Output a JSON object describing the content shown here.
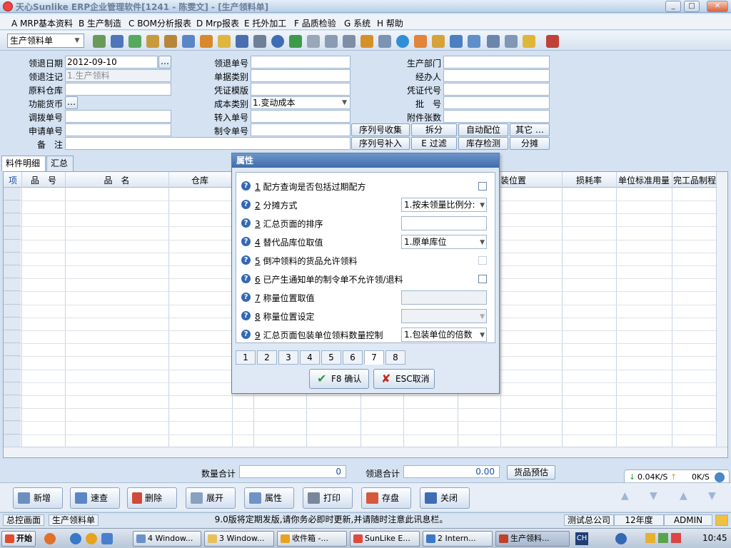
{
  "window": {
    "title": "天心Sunlike ERP企业管理软件[1241 - 陈雯文] - [生产领料单]",
    "min": "_",
    "max": "□",
    "close": "✕"
  },
  "menu": [
    "A MRP基本资料",
    "B 生产制造",
    "C BOM分析报表",
    "D Mrp报表",
    "E 托外加工",
    "F 品质检验",
    "G 系统",
    "H 帮助"
  ],
  "toolbar": {
    "doc_type": "生产领料单"
  },
  "form": {
    "fields": [
      {
        "label": "领退日期",
        "value": "2012-09-10"
      },
      {
        "label": "领退注记",
        "value": "1.生产领料"
      },
      {
        "label": "原料仓库",
        "value": ""
      },
      {
        "label": "功能货币",
        "value": ""
      },
      {
        "label": "调拨单号",
        "value": ""
      },
      {
        "label": "申请单号",
        "value": ""
      },
      {
        "label": "备　注",
        "value": ""
      },
      {
        "label": "领退单号",
        "value": ""
      },
      {
        "label": "单据类别",
        "value": ""
      },
      {
        "label": "凭证模版",
        "value": ""
      },
      {
        "label": "成本类别",
        "value": "1.变动成本"
      },
      {
        "label": "转入单号",
        "value": ""
      },
      {
        "label": "制令单号",
        "value": ""
      },
      {
        "label": "生产部门",
        "value": ""
      },
      {
        "label": "经办人",
        "value": ""
      },
      {
        "label": "凭证代号",
        "value": ""
      },
      {
        "label": "批　号",
        "value": ""
      },
      {
        "label": "附件张数",
        "value": ""
      }
    ],
    "ellipsis": "…",
    "buttons": [
      "序列号收集",
      "拆分",
      "自动配位",
      "其它 …",
      "序列号补入",
      "E 过滤",
      "库存检测",
      "分摊"
    ]
  },
  "tabs": [
    "料件明细",
    "汇总"
  ],
  "grid": {
    "columns": [
      "项",
      "品　号",
      "品　名",
      "仓库",
      "装位置",
      "损耗率",
      "单位标准用量",
      "完工品制程"
    ]
  },
  "summary": {
    "qty_label": "数量合计",
    "qty_value": "0",
    "return_label": "领退合计",
    "return_value": "0.00",
    "preview": "货品预估",
    "net_down": "0.04K/S",
    "net_up": "0K/S"
  },
  "bottom_buttons": [
    "新增",
    "速查",
    "删除",
    "展开",
    "属性",
    "打印",
    "存盘",
    "关闭"
  ],
  "status": {
    "home": "总控画面",
    "doc": "生产领料单",
    "message": "9.0版将定期发版,请你务必即时更新,并请随时注意此讯息栏。",
    "company": "测试总公司",
    "year": "12年度",
    "user": "ADMIN"
  },
  "taskbar": {
    "start": "开始",
    "tasks": [
      "4 Window...",
      "3 Window...",
      "收件箱 -...",
      "SunLike E...",
      "2 Intern...",
      "生产领料..."
    ],
    "lang": "CH",
    "time": "10:45"
  },
  "dialog": {
    "title": "属性",
    "props": [
      {
        "num": "1",
        "text": "配方查询是否包括过期配方",
        "type": "checkbox",
        "value": ""
      },
      {
        "num": "2",
        "text": "分摊方式",
        "type": "combo",
        "value": "1.按未领量比例分:"
      },
      {
        "num": "3",
        "text": "汇总页面的排序",
        "type": "text",
        "value": ""
      },
      {
        "num": "4",
        "text": "替代品库位取值",
        "type": "combo",
        "value": "1.原单库位"
      },
      {
        "num": "5",
        "text": "倒冲领料的货品允许领料",
        "type": "checkbox-dis",
        "value": ""
      },
      {
        "num": "6",
        "text": "已产生通知单的制令单不允许领/退料",
        "type": "checkbox",
        "value": ""
      },
      {
        "num": "7",
        "text": "称量位置取值",
        "type": "dis",
        "value": ""
      },
      {
        "num": "8",
        "text": "称量位置设定",
        "type": "combo-dis",
        "value": ""
      },
      {
        "num": "9",
        "text": "汇总页面包装单位领料数量控制",
        "type": "combo",
        "value": "1.包装单位的倍数"
      }
    ],
    "pages": [
      "1",
      "2",
      "3",
      "4",
      "5",
      "6",
      "7",
      "8"
    ],
    "ok": "F8 确认",
    "cancel": "ESC取消"
  }
}
